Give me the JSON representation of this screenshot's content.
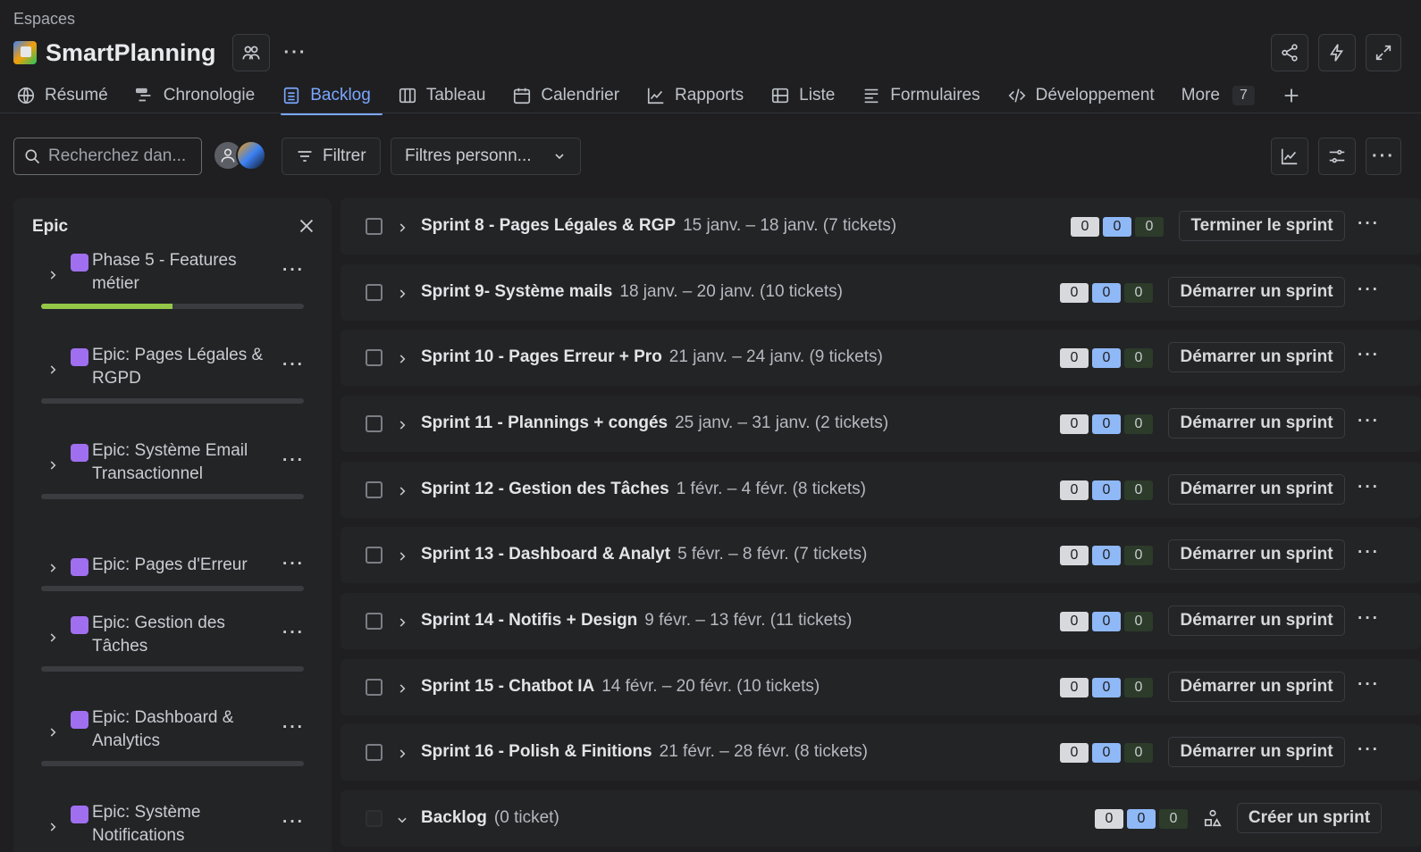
{
  "breadcrumb": "Espaces",
  "project": {
    "title": "SmartPlanning"
  },
  "tabs": [
    {
      "label": "Résumé",
      "icon": "globe-icon"
    },
    {
      "label": "Chronologie",
      "icon": "timeline-icon"
    },
    {
      "label": "Backlog",
      "icon": "backlog-icon",
      "active": true
    },
    {
      "label": "Tableau",
      "icon": "board-icon"
    },
    {
      "label": "Calendrier",
      "icon": "calendar-icon"
    },
    {
      "label": "Rapports",
      "icon": "reports-icon"
    },
    {
      "label": "Liste",
      "icon": "list-icon"
    },
    {
      "label": "Formulaires",
      "icon": "forms-icon"
    },
    {
      "label": "Développement",
      "icon": "code-icon"
    }
  ],
  "more_tab": {
    "label": "More",
    "count": "7"
  },
  "toolbar": {
    "search_placeholder": "Recherchez dan...",
    "filter_label": "Filtrer",
    "custom_filters_label": "Filtres personn..."
  },
  "sidebar": {
    "title": "Epic",
    "epics": [
      {
        "name": "Phase 5 - Features métier",
        "progress": 0.5
      },
      {
        "name": "Epic: Pages Légales & RGPD",
        "progress": 0
      },
      {
        "name": "Epic: Système Email Transactionnel",
        "progress": 0
      },
      {
        "name": "Epic: Pages d'Erreur",
        "progress": 0
      },
      {
        "name": "Epic: Gestion des Tâches",
        "progress": 0
      },
      {
        "name": "Epic: Dashboard & Analytics",
        "progress": 0
      },
      {
        "name": "Epic: Système Notifications",
        "progress": 0
      }
    ]
  },
  "sprints": [
    {
      "name": "Sprint 8 - Pages Légales & RGP",
      "meta": "15 janv. – 18 janv. (7 tickets)",
      "counts": [
        "0",
        "0",
        "0"
      ],
      "action": "Terminer le sprint"
    },
    {
      "name": "Sprint 9- Système mails",
      "meta": "18 janv. – 20 janv. (10 tickets)",
      "counts": [
        "0",
        "0",
        "0"
      ],
      "action": "Démarrer un sprint"
    },
    {
      "name": "Sprint 10 - Pages Erreur + Pro",
      "meta": "21 janv. – 24 janv. (9 tickets)",
      "counts": [
        "0",
        "0",
        "0"
      ],
      "action": "Démarrer un sprint"
    },
    {
      "name": "Sprint 11 - Plannings + congés",
      "meta": "25 janv. – 31 janv. (2 tickets)",
      "counts": [
        "0",
        "0",
        "0"
      ],
      "action": "Démarrer un sprint"
    },
    {
      "name": "Sprint 12 - Gestion des Tâches",
      "meta": "1 févr. – 4 févr. (8 tickets)",
      "counts": [
        "0",
        "0",
        "0"
      ],
      "action": "Démarrer un sprint"
    },
    {
      "name": "Sprint 13 - Dashboard & Analyt",
      "meta": "5 févr. – 8 févr. (7 tickets)",
      "counts": [
        "0",
        "0",
        "0"
      ],
      "action": "Démarrer un sprint"
    },
    {
      "name": "Sprint 14 - Notifis + Design",
      "meta": "9 févr. – 13 févr. (11 tickets)",
      "counts": [
        "0",
        "0",
        "0"
      ],
      "action": "Démarrer un sprint"
    },
    {
      "name": "Sprint 15 - Chatbot IA",
      "meta": "14 févr. – 20 févr. (10 tickets)",
      "counts": [
        "0",
        "0",
        "0"
      ],
      "action": "Démarrer un sprint"
    },
    {
      "name": "Sprint 16 - Polish & Finitions",
      "meta": "21 févr. – 28 févr. (8 tickets)",
      "counts": [
        "0",
        "0",
        "0"
      ],
      "action": "Démarrer un sprint"
    }
  ],
  "backlog": {
    "name": "Backlog",
    "meta": "(0 ticket)",
    "counts": [
      "0",
      "0",
      "0"
    ],
    "action": "Créer un sprint"
  },
  "colors": {
    "accent": "#7aa7ff",
    "epic": "#9f6ff0",
    "progress": "#94c748"
  }
}
